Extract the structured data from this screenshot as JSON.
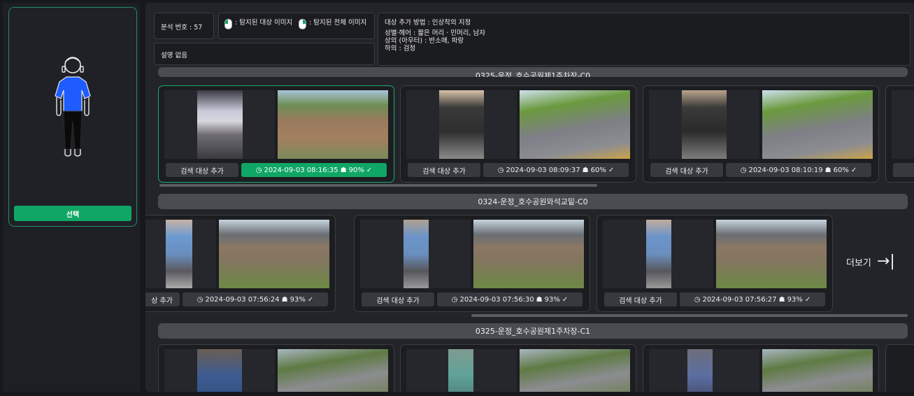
{
  "left_panel": {
    "select_label": "선택"
  },
  "header": {
    "analysis_label": "분석 번호 : 57",
    "legend_target": ": 탐지된 대상 이미지",
    "legend_all": ": 탐지된 전체 이미지",
    "description": "설명 없음",
    "method_line": "대상 추가 방법 : 인상착의 지정",
    "attr_line1": "성별·헤어 : 짧은 머리 · 민머리, 남자",
    "attr_line2": "상의 (아우터) : 반소매, 파랑",
    "attr_line3": "하의 : 검정"
  },
  "rows": [
    {
      "title": "0325-운정_호수공원제1주차장-C0",
      "cards": [
        {
          "add_label": "검색 대상 추가",
          "time": "2024-09-03 08:16:35",
          "score": "90%",
          "selected": true
        },
        {
          "add_label": "검색 대상 추가",
          "time": "2024-09-03 08:09:37",
          "score": "60%",
          "selected": false
        },
        {
          "add_label": "검색 대상 추가",
          "time": "2024-09-03 08:10:19",
          "score": "60%",
          "selected": false
        }
      ]
    },
    {
      "title": "0324-운정_호수공원와석교밑-C0",
      "cards": [
        {
          "add_label": "상 추가",
          "time": "2024-09-03 07:56:24",
          "score": "93%",
          "selected": false
        },
        {
          "add_label": "검색 대상 추가",
          "time": "2024-09-03 07:56:30",
          "score": "93%",
          "selected": false
        },
        {
          "add_label": "검색 대상 추가",
          "time": "2024-09-03 07:56:27",
          "score": "93%",
          "selected": false
        }
      ],
      "more_label": "더보기"
    },
    {
      "title": "0325-운정_호수공원제1주차장-C1",
      "cards": []
    }
  ],
  "colors": {
    "accent": "#10a665",
    "selected_border": "#1fa872"
  }
}
